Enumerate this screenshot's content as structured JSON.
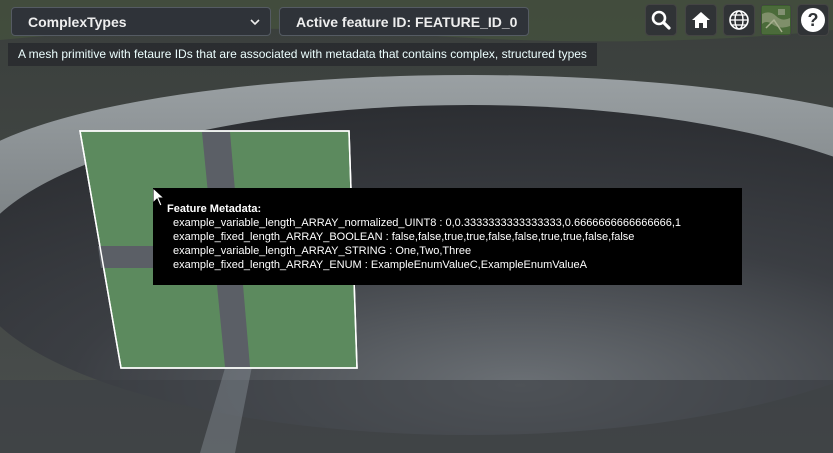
{
  "toolbar": {
    "example_select": "ComplexTypes",
    "feature_id_select": "Active feature ID: FEATURE_ID_0"
  },
  "description": "A mesh primitive with fetaure IDs that are associated with metadata that contains complex, structured types",
  "icons": {
    "search": "search-icon",
    "home": "home-icon",
    "scene_mode": "globe-icon",
    "base_layer": "imagery-thumbnail-icon",
    "help": "help-icon"
  },
  "tooltip": {
    "title": "Feature Metadata:",
    "lines": [
      "example_variable_length_ARRAY_normalized_UINT8 : 0,0.3333333333333333,0.6666666666666666,1",
      "example_fixed_length_ARRAY_BOOLEAN : false,false,true,true,false,false,true,true,false,false",
      "example_variable_length_ARRAY_STRING : One,Two,Three",
      "example_fixed_length_ARRAY_ENUM : ExampleEnumValueC,ExampleEnumValueA"
    ]
  },
  "colors": {
    "mesh_green": "#5c8a5e",
    "mesh_stripe": "#5b5f66",
    "toolbar_bg": "#2f3339",
    "tooltip_bg": "#000000"
  }
}
